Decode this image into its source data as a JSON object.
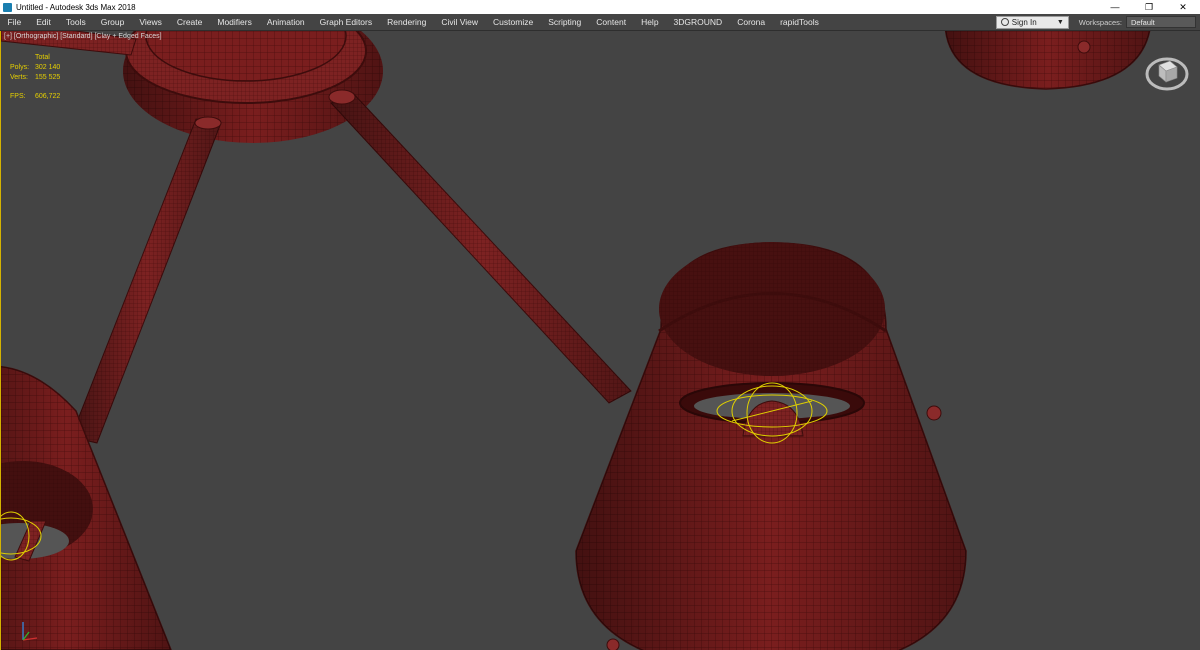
{
  "window": {
    "title": "Untitled - Autodesk 3ds Max 2018",
    "app_icon": "3ds-max-icon",
    "controls": {
      "minimize": "—",
      "maximize": "❐",
      "close": "✕"
    }
  },
  "menubar": {
    "items": [
      "File",
      "Edit",
      "Tools",
      "Group",
      "Views",
      "Create",
      "Modifiers",
      "Animation",
      "Graph Editors",
      "Rendering",
      "Civil View",
      "Customize",
      "Scripting",
      "Content",
      "Help",
      "3DGROUND",
      "Corona",
      "rapidTools"
    ],
    "signin": {
      "label": "Sign In",
      "icon": "user-icon",
      "caret": "▼"
    },
    "workspaces": {
      "label": "Workspaces:",
      "value": "Default"
    }
  },
  "viewport": {
    "label": "[+] [Orthographic] [Standard] [Clay + Edged Faces]",
    "stats": {
      "header": "Total",
      "polys_label": "Polys:",
      "polys": "302 140",
      "verts_label": "Verts:",
      "verts": "155 525",
      "fps_label": "FPS:",
      "fps": "606,722"
    },
    "viewcube_icon": "viewcube-icon",
    "axis_icon": "axis-tripod-icon",
    "colors": {
      "background": "#444444",
      "model": "#7a1e1e",
      "model_dark": "#3d0c0c",
      "wire": "#4a0d0d",
      "light_helper": "#e0d000",
      "stats_text": "#e6d000",
      "border_active": "#d4b200"
    }
  }
}
